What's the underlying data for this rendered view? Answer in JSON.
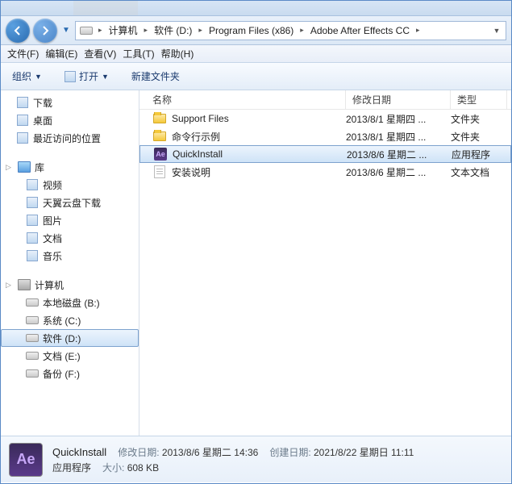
{
  "breadcrumbs": [
    "计算机",
    "软件 (D:)",
    "Program Files (x86)",
    "Adobe After Effects CC"
  ],
  "menubar": {
    "file": "文件(F)",
    "edit": "编辑(E)",
    "view": "查看(V)",
    "tools": "工具(T)",
    "help": "帮助(H)"
  },
  "toolbar": {
    "organize": "组织",
    "open": "打开",
    "newfolder": "新建文件夹"
  },
  "columns": {
    "name": "名称",
    "date": "修改日期",
    "type": "类型"
  },
  "sidebar": {
    "favorites": [
      {
        "label": "下载",
        "icon": "download"
      },
      {
        "label": "桌面",
        "icon": "desktop"
      },
      {
        "label": "最近访问的位置",
        "icon": "recent"
      }
    ],
    "libraries_header": "库",
    "libraries": [
      {
        "label": "视频",
        "icon": "video"
      },
      {
        "label": "天翼云盘下载",
        "icon": "cloud"
      },
      {
        "label": "图片",
        "icon": "pictures"
      },
      {
        "label": "文档",
        "icon": "docs"
      },
      {
        "label": "音乐",
        "icon": "music"
      }
    ],
    "computer_header": "计算机",
    "drives": [
      {
        "label": "本地磁盘 (B:)",
        "sel": false
      },
      {
        "label": "系统 (C:)",
        "sel": false
      },
      {
        "label": "软件 (D:)",
        "sel": true
      },
      {
        "label": "文档 (E:)",
        "sel": false
      },
      {
        "label": "备份 (F:)",
        "sel": false
      }
    ]
  },
  "files": [
    {
      "name": "Support Files",
      "date": "2013/8/1 星期四 ...",
      "type": "文件夹",
      "icon": "folder",
      "sel": false
    },
    {
      "name": "命令行示例",
      "date": "2013/8/1 星期四 ...",
      "type": "文件夹",
      "icon": "folder",
      "sel": false
    },
    {
      "name": "QuickInstall",
      "date": "2013/8/6 星期二 ...",
      "type": "应用程序",
      "icon": "ae",
      "sel": true
    },
    {
      "name": "安装说明",
      "date": "2013/8/6 星期二 ...",
      "type": "文本文档",
      "icon": "txt",
      "sel": false
    }
  ],
  "details": {
    "name": "QuickInstall",
    "type": "应用程序",
    "mod_label": "修改日期:",
    "mod_val": "2013/8/6 星期二 14:36",
    "created_label": "创建日期:",
    "created_val": "2021/8/22 星期日 11:11",
    "size_label": "大小:",
    "size_val": "608 KB"
  }
}
